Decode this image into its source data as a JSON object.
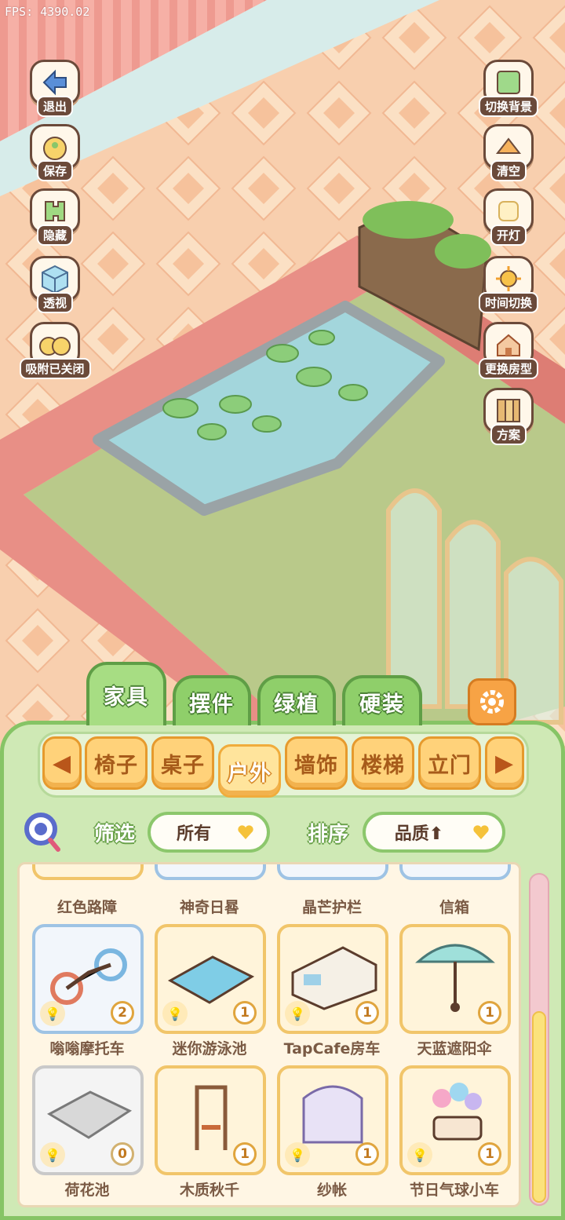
{
  "fps": "FPS: 4390.02",
  "left_tools": [
    {
      "label": "退出",
      "icon": "exit-icon"
    },
    {
      "label": "保存",
      "icon": "save-duck-icon"
    },
    {
      "label": "隐藏",
      "icon": "hide-icon"
    },
    {
      "label": "透视",
      "icon": "perspective-cube-icon"
    },
    {
      "label": "吸附已关闭",
      "icon": "snap-off-ducks-icon"
    }
  ],
  "right_tools": [
    {
      "label": "切换背景",
      "icon": "switch-background-icon"
    },
    {
      "label": "清空",
      "icon": "clear-icon"
    },
    {
      "label": "开灯",
      "icon": "light-icon"
    },
    {
      "label": "时间切换",
      "icon": "time-switch-icon"
    },
    {
      "label": "更换房型",
      "icon": "house-icon"
    },
    {
      "label": "方案",
      "icon": "plan-icon"
    }
  ],
  "category_tabs": [
    "家具",
    "摆件",
    "绿植",
    "硬装"
  ],
  "active_category": "家具",
  "sub_tabs": [
    "椅子",
    "桌子",
    "户外",
    "墙饰",
    "楼梯",
    "立门"
  ],
  "active_sub_tab": "户外",
  "filter": {
    "label": "筛选",
    "value": "所有"
  },
  "sort": {
    "label": "排序",
    "value": "品质⬆"
  },
  "items_partial_row": [
    "红色路障",
    "神奇日晷",
    "晶芒护栏",
    "信箱"
  ],
  "items": [
    {
      "name": "嗡嗡摩托车",
      "count": "2",
      "art": "motorbike-icon"
    },
    {
      "name": "迷你游泳池",
      "count": "1",
      "art": "pool-icon"
    },
    {
      "name": "TapCafe房车",
      "count": "1",
      "art": "camper-van-icon"
    },
    {
      "name": "天蓝遮阳伞",
      "count": "1",
      "art": "umbrella-icon"
    },
    {
      "name": "荷花池",
      "count": "0",
      "art": "lotus-pond-icon"
    },
    {
      "name": "木质秋千",
      "count": "1",
      "art": "swing-icon"
    },
    {
      "name": "纱帐",
      "count": "1",
      "art": "canopy-bed-icon"
    },
    {
      "name": "节日气球小车",
      "count": "1",
      "art": "balloon-cart-icon"
    }
  ],
  "colors": {
    "floor_tile": "#f8cfae",
    "lawn": "#b9c98a",
    "wall": "#e88f86",
    "panel_green": "#cfe9b5",
    "tab_green": "#8fcf6a",
    "sub_orange": "#ffd27a"
  }
}
